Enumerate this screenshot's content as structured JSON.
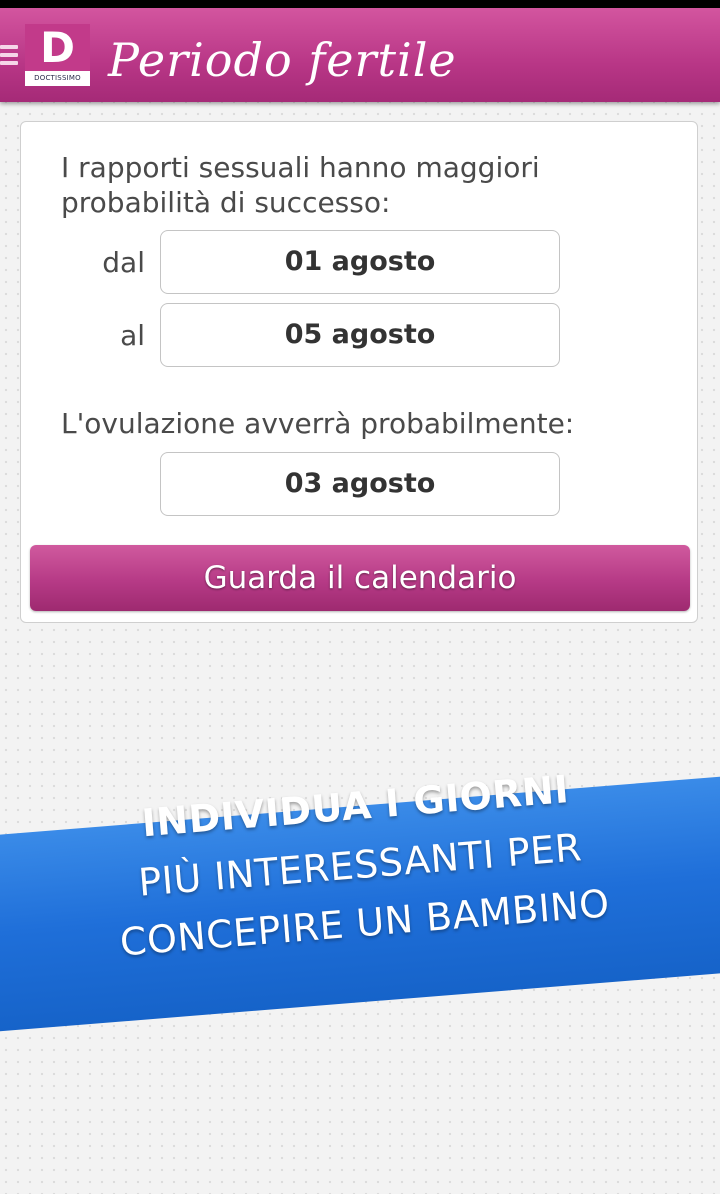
{
  "app_bar": {
    "title": "Periodo fertile",
    "logo_letter": "D",
    "logo_text": "DOCTISSIMO",
    "menu_icon": "hamburger-menu-icon"
  },
  "result": {
    "intro": "I rapporti sessuali hanno maggiori probabilità di successo:",
    "from_label": "dal",
    "from_date": "01 agosto",
    "to_label": "al",
    "to_date": "05 agosto",
    "ovulation_label": "L'ovulazione avverrà probabilmente:",
    "ovulation_date": "03 agosto",
    "calendar_button_label": "Guarda il calendario"
  },
  "banner": {
    "line1": "INDIVIDUA I GIORNI",
    "line2": "PIÙ INTERESSANTI PER",
    "line3": "CONCEPIRE UN BAMBINO"
  },
  "colors": {
    "brand": "#b83686",
    "banner": "#1f6fd9"
  }
}
